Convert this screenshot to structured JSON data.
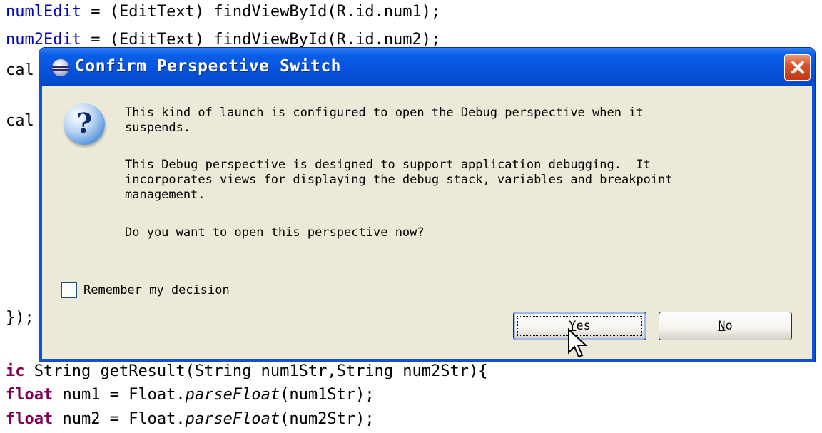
{
  "code": {
    "line1_var": "numlEdit",
    "line1_rest": " = (EditText) findViewById(R.id.num1);",
    "line2_var": "num2Edit",
    "line2_rest": " = (EditText) findViewById(R.id.num2);",
    "line3": "cal",
    "line4": "cal",
    "line5": "});",
    "line6_kw": "ic",
    "line6_rest": " String getResult(String num1Str,String num2Str){",
    "line7_kw": "float",
    "line7_mid": " num1 = Float.",
    "line7_method": "parseFloat",
    "line7_end": "(num1Str);",
    "line8_kw": "float",
    "line8_mid": " num2 = Float.",
    "line8_method": "parseFloat",
    "line8_end": "(num2Str);",
    "num1_id": "num1",
    "num2_id": "num2"
  },
  "dialog": {
    "title": "Confirm Perspective Switch",
    "message_line1": "This kind of launch is configured to open the Debug perspective when it",
    "message_line2": "suspends.",
    "message_para2_line1": "This Debug perspective is designed to support application debugging.  It",
    "message_para2_line2": "incorporates views for displaying the debug stack, variables and breakpoint",
    "message_para2_line3": "management.",
    "question": "Do you want to open this perspective now?",
    "remember_checked": false,
    "remember_label_mnemonic": "R",
    "remember_label_rest": "emember my decision",
    "yes_mnemonic": "Y",
    "yes_rest": "es",
    "no_mnemonic": "N",
    "no_rest": "o"
  },
  "icons": {
    "title": "eclipse-icon",
    "question": "question-icon",
    "close": "close-icon"
  },
  "colors": {
    "titlebar": "#0652db",
    "dialog_bg": "#ece9d8",
    "close_button": "#d9542c",
    "keyword": "#7f0055",
    "field": "#0000c0"
  }
}
